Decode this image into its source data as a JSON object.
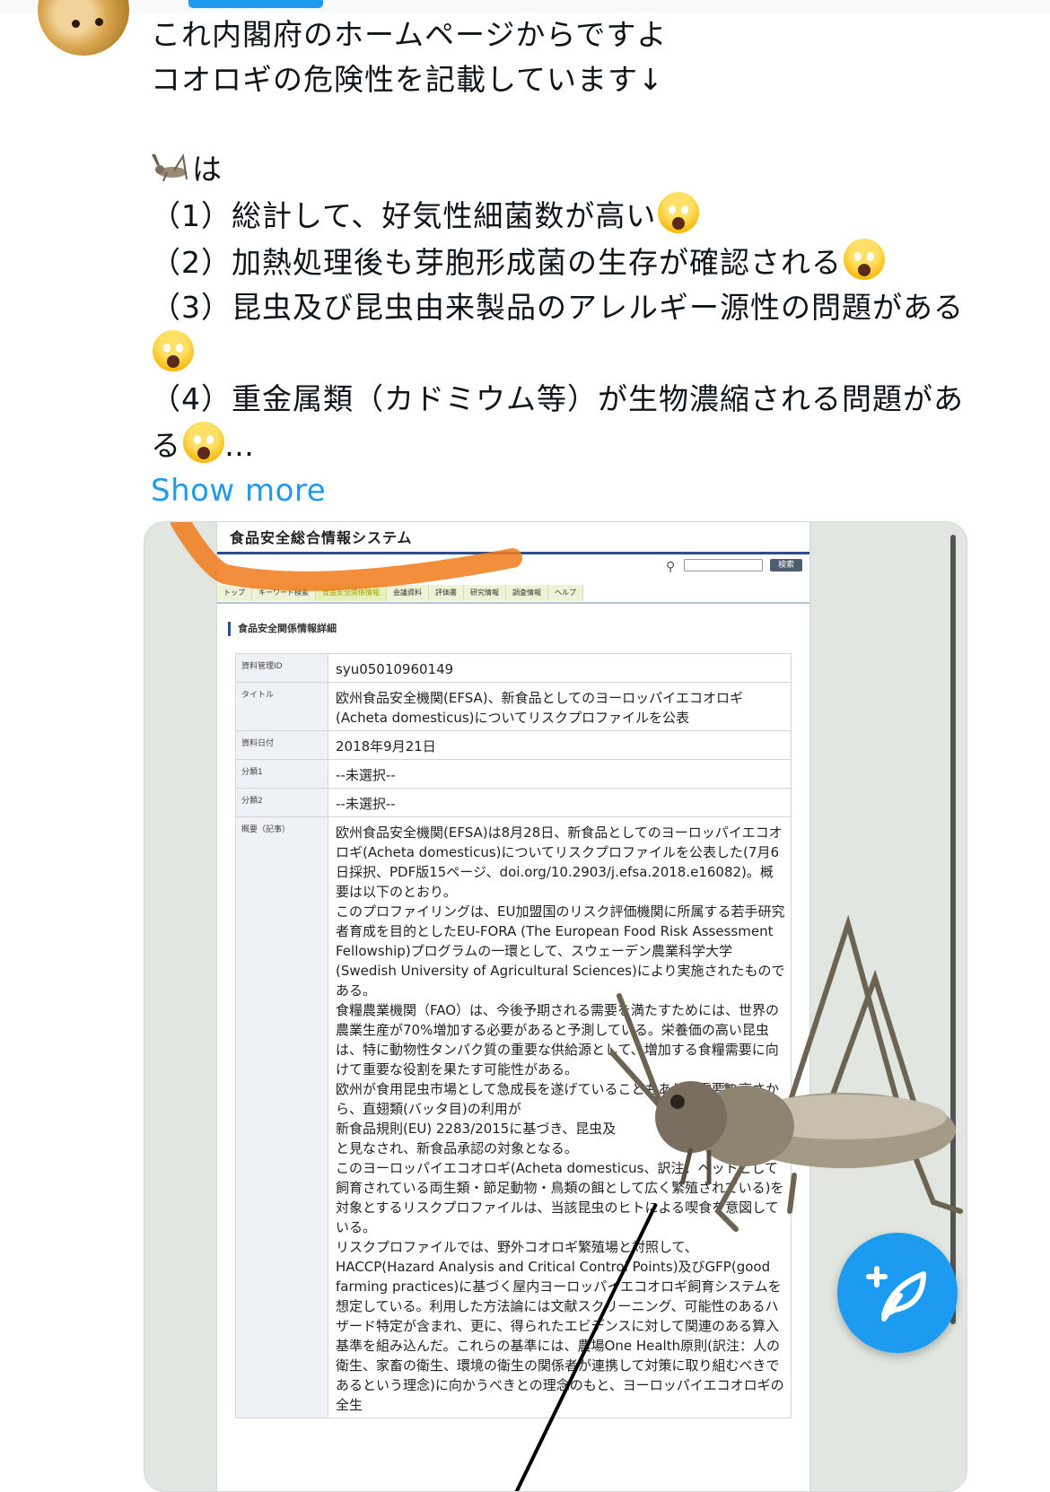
{
  "tweet": {
    "lines": [
      "これ内閣府のホームページからですよ",
      "コオロギの危険性を記載しています↓"
    ],
    "cricket_line_suffix": "は",
    "point1": "（1）総計して、好気性細菌数が高い",
    "point2": "（2）加熱処理後も芽胞形成菌の生存が確認される",
    "point3": "（3）昆虫及び昆虫由来製品のアレルギー源性の問題がある",
    "point4a": "（4）重金属類（カドミウム等）が生物濃縮される問題があ",
    "point4b": "る",
    "ellipsis": "…",
    "show_more": "Show more"
  },
  "doc": {
    "site_title": "食品安全総合情報システム",
    "search_button": "検索",
    "nav": [
      "トップ",
      "キーワード検索",
      "食品安全関係情報",
      "会議資料",
      "評価書",
      "研究情報",
      "調査情報",
      "ヘルプ"
    ],
    "active_nav": "食品安全関係情報",
    "section_heading": "食品安全関係情報詳細",
    "rows": [
      {
        "key": "資料管理ID",
        "value": "syu05010960149"
      },
      {
        "key": "タイトル",
        "value": "欧州食品安全機関(EFSA)、新食品としてのヨーロッパイエコオロギ(Acheta domesticus)についてリスクプロファイルを公表"
      },
      {
        "key": "資料日付",
        "value": "2018年9月21日"
      },
      {
        "key": "分類1",
        "value": "--未選択--"
      },
      {
        "key": "分類2",
        "value": "--未選択--"
      },
      {
        "key": "概要（記事）",
        "value": "欧州食品安全機関(EFSA)は8月28日、新食品としてのヨーロッパイエコオロギ(Acheta domesticus)についてリスクプロファイルを公表した(7月6日採択、PDF版15ページ、doi.org/10.2903/j.efsa.2018.e16082)。概要は以下のとおり。\nこのプロファイリングは、EU加盟国のリスク評価機関に所属する若手研究者育成を目的としたEU-FORA (The European Food Risk Assessment Fellowship)プログラムの一環として、スウェーデン農業科学大学(Swedish University of Agricultural Sciences)により実施されたものである。\n食糧農業機関（FAO）は、今後予期される需要を満たすためには、世界の農業生産が70%増加する必要があると予測している。栄養価の高い昆虫は、特に動物性タンパク質の重要な供給源として、増加する食糧需要に向けて重要な役割を果たす可能性がある。\n欧州が食用昆虫市場として急成長を遂げていることもあり、需要の高さから、直翅類(バッタ目)の利用が\n新食品規則(EU) 2283/2015に基づき、昆虫及\nと見なされ、新食品承認の対象となる。\nこのヨーロッパイエコオロギ(Acheta domesticus、訳注：ペットとして飼育されている両生類・節足動物・鳥類の餌として広く繁殖されている)を対象とするリスクプロファイルは、当該昆虫のヒトによる喫食を意図している。\nリスクプロファイルでは、野外コオロギ繁殖場と対照して、HACCP(Hazard Analysis and Critical Control Points)及びGFP(good farming practices)に基づく屋内ヨーロッパイエコオロギ飼育システムを想定している。利用した方法論には文献スクリーニング、可能性のあるハザード特定が含まれ、更に、得られたエビデンスに対して関連のある算入基準を組み込んだ。これらの基準には、農場One Health原則(訳注：人の衛生、家畜の衛生、環境の衛生の関係者が連携して対策に取り組むべきであるという理念)に向かうべきとの理念のもと、ヨーロッパイエコオロギの全生"
      }
    ]
  },
  "icons": {
    "emoji": "face-screaming-in-fear",
    "cricket": "cricket",
    "fab": "compose-feather-plus"
  },
  "colors": {
    "accent": "#1d9bf0",
    "highlight": "#f07a1a"
  }
}
